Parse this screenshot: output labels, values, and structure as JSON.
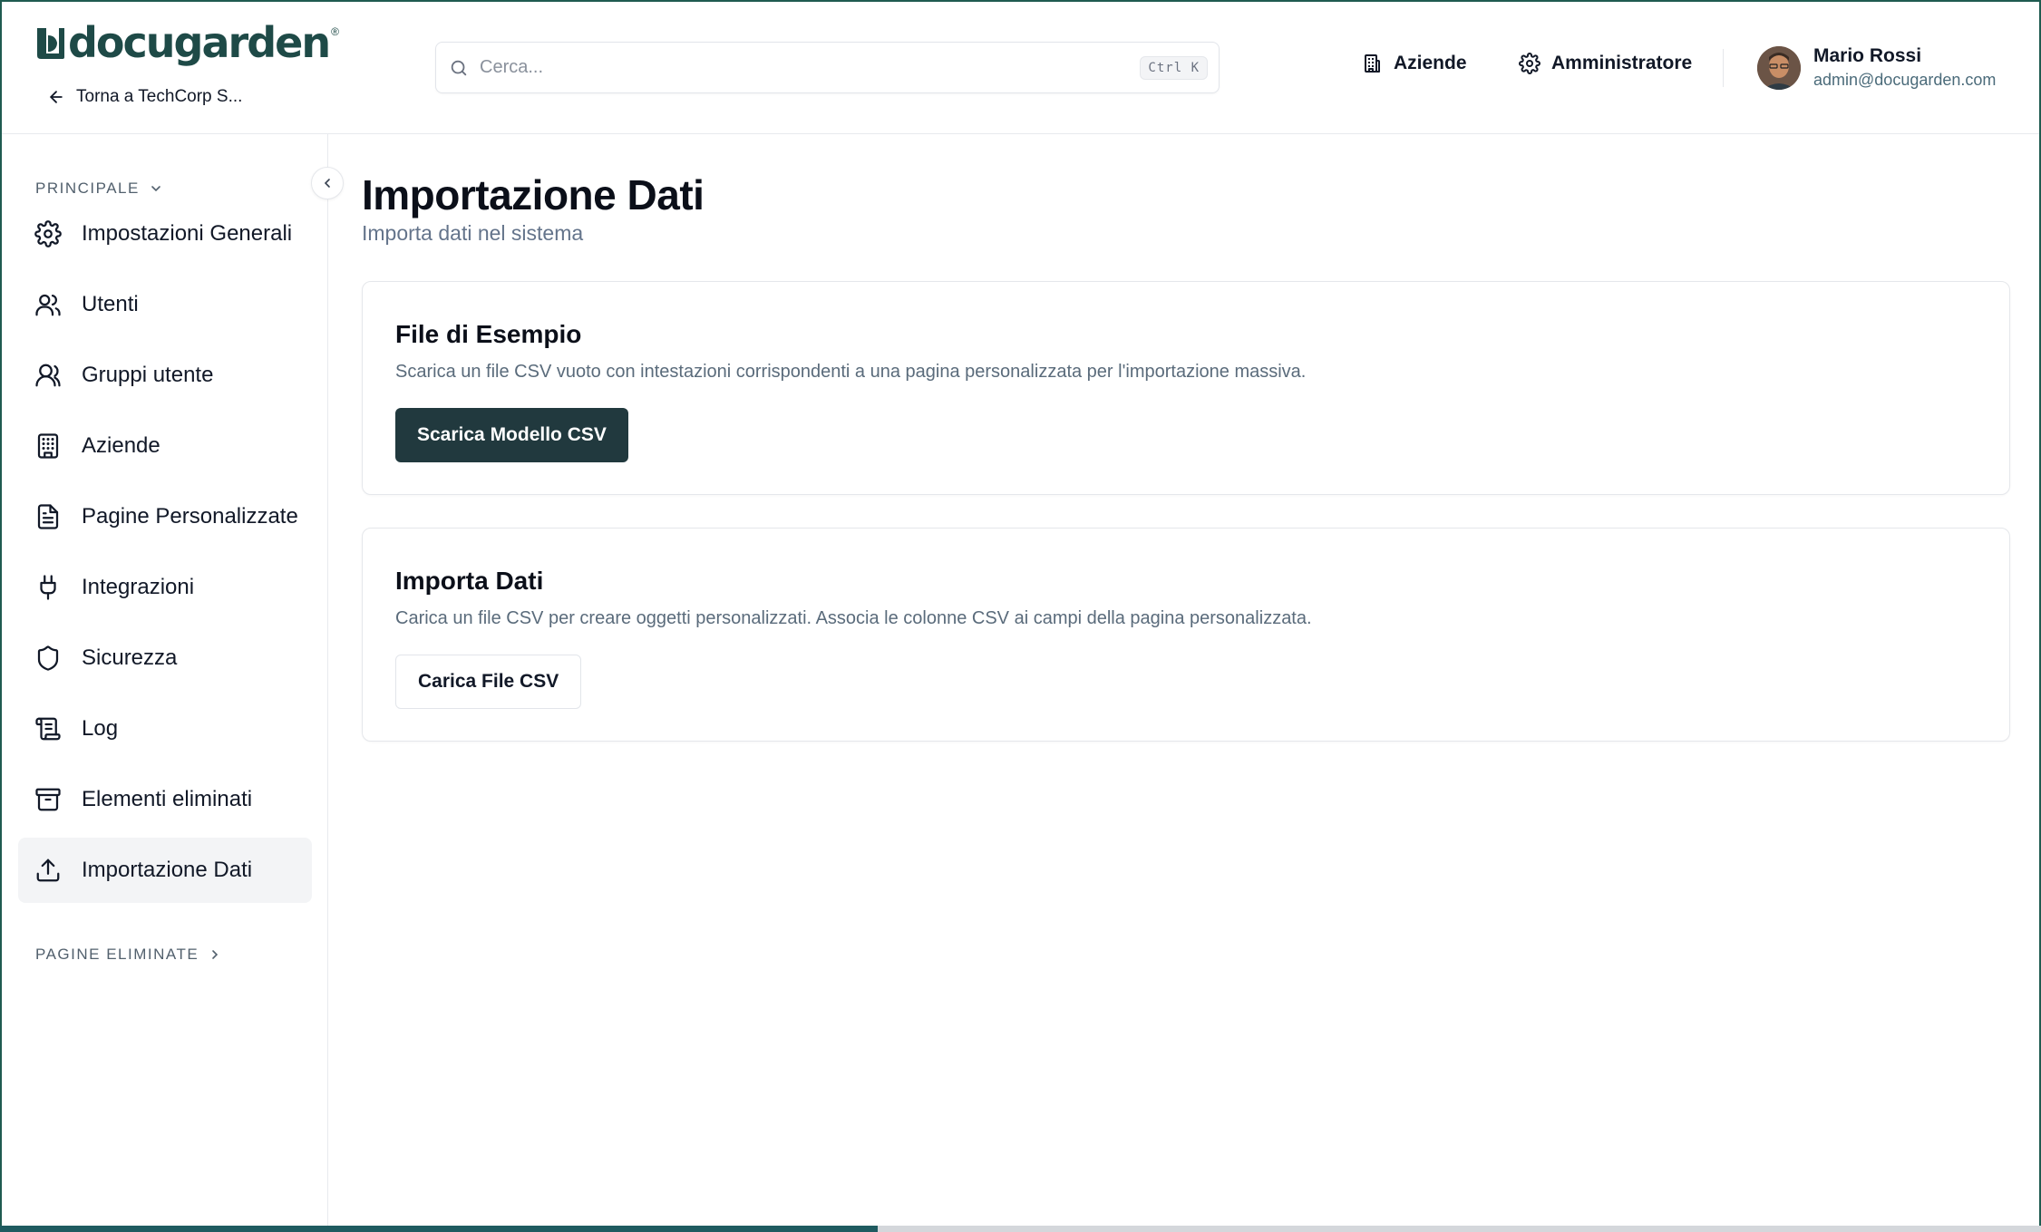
{
  "brand": {
    "name": "docugarden",
    "color": "#1e4a47"
  },
  "header": {
    "back_link": "Torna a TechCorp S...",
    "search": {
      "placeholder": "Cerca...",
      "shortcut": "Ctrl K"
    },
    "nav": [
      {
        "label": "Aziende",
        "icon": "building-icon"
      },
      {
        "label": "Amministratore",
        "icon": "gear-icon"
      }
    ],
    "user": {
      "name": "Mario Rossi",
      "email": "admin@docugarden.com"
    }
  },
  "sidebar": {
    "section_main": "PRINCIPALE",
    "items": [
      {
        "label": "Impostazioni Generali",
        "icon": "gear-icon"
      },
      {
        "label": "Utenti",
        "icon": "users-icon"
      },
      {
        "label": "Gruppi utente",
        "icon": "user-group-icon"
      },
      {
        "label": "Aziende",
        "icon": "building-icon"
      },
      {
        "label": "Pagine Personalizzate",
        "icon": "document-icon"
      },
      {
        "label": "Integrazioni",
        "icon": "plug-icon"
      },
      {
        "label": "Sicurezza",
        "icon": "shield-icon"
      },
      {
        "label": "Log",
        "icon": "scroll-icon"
      },
      {
        "label": "Elementi eliminati",
        "icon": "archive-icon"
      },
      {
        "label": "Importazione Dati",
        "icon": "upload-icon",
        "active": true
      }
    ],
    "section_deleted": "PAGINE ELIMINATE"
  },
  "main": {
    "title": "Importazione Dati",
    "subtitle": "Importa dati nel sistema",
    "cards": [
      {
        "title": "File di Esempio",
        "description": "Scarica un file CSV vuoto con intestazioni corrispondenti a una pagina personalizzata per l'importazione massiva.",
        "button": "Scarica Modello CSV"
      },
      {
        "title": "Importa Dati",
        "description": "Carica un file CSV per creare oggetti personalizzati. Associa le colonne CSV ai campi della pagina personalizzata.",
        "button": "Carica File CSV"
      }
    ]
  },
  "progress": {
    "value_percent": 43,
    "color": "#1f5b60"
  }
}
